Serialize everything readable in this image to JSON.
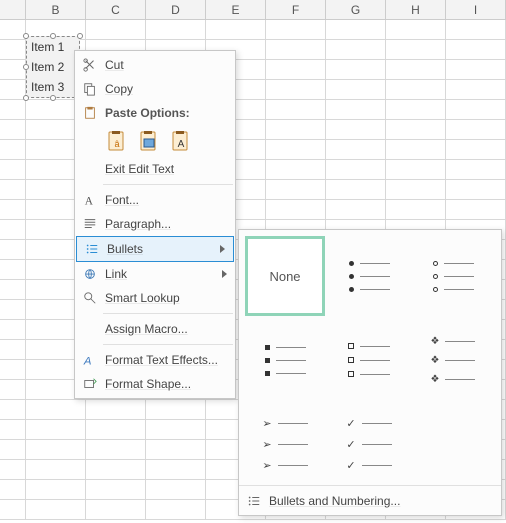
{
  "grid": {
    "columns": [
      "B",
      "C",
      "D",
      "E",
      "F",
      "G",
      "H",
      "I"
    ]
  },
  "shape": {
    "items": [
      "Item 1",
      "Item 2",
      "Item 3"
    ]
  },
  "menu": {
    "cut": "Cut",
    "copy": "Copy",
    "paste_options": "Paste Options:",
    "exit_edit": "Exit Edit Text",
    "font": "Font...",
    "paragraph": "Paragraph...",
    "bullets": "Bullets",
    "link": "Link",
    "smart_lookup": "Smart Lookup",
    "assign_macro": "Assign Macro...",
    "format_text_effects": "Format Text Effects...",
    "format_shape": "Format Shape..."
  },
  "flyout": {
    "none": "None",
    "footer": "Bullets and Numbering..."
  }
}
